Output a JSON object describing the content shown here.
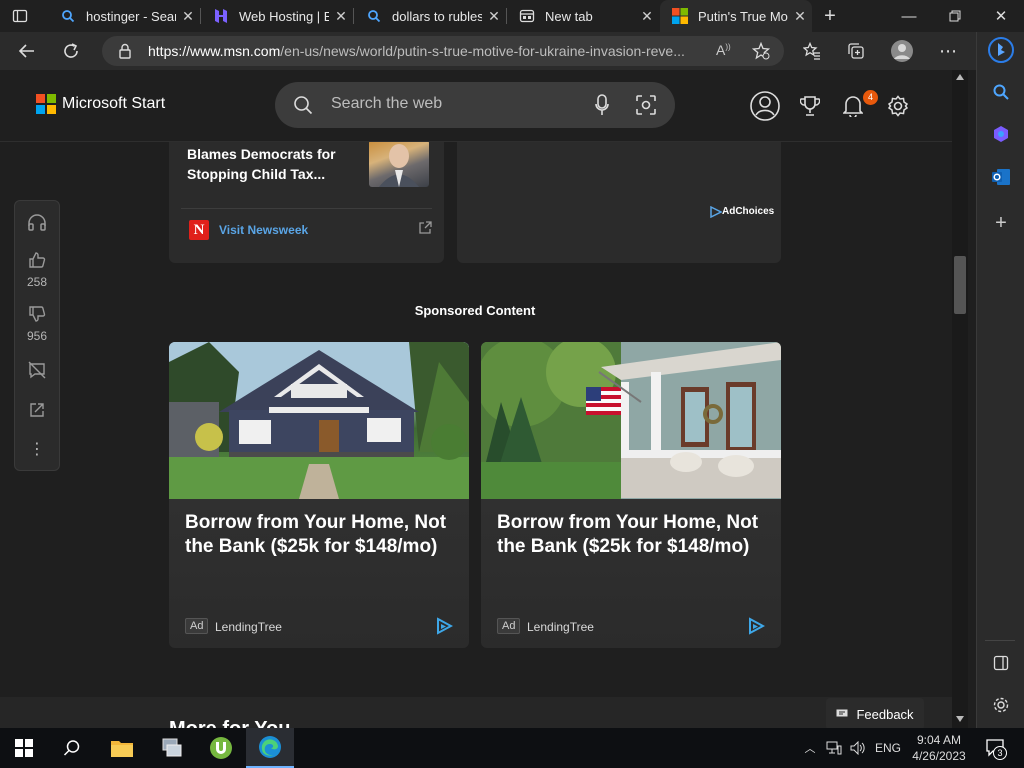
{
  "browser": {
    "tabs": [
      {
        "label": "hostinger - Search",
        "active": false
      },
      {
        "label": "Web Hosting | Ex",
        "active": false
      },
      {
        "label": "dollars to rubles",
        "active": false
      },
      {
        "label": "New tab",
        "active": false
      },
      {
        "label": "Putin's True Mot",
        "active": true
      }
    ],
    "url_host": "https://www.msn.com",
    "url_path": "/en-us/news/world/putin-s-true-motive-for-ukraine-invasion-reve..."
  },
  "header": {
    "brand": "Microsoft Start",
    "search_placeholder": "Search the web",
    "notification_count": "4"
  },
  "sidetools": {
    "likes": "258",
    "dislikes": "956"
  },
  "top_card": {
    "headline": "Blames Democrats for Stopping Child Tax...",
    "visit_link": "Visit Newsweek"
  },
  "ad_panel": {
    "adchoices": "AdChoices"
  },
  "sponsored": {
    "heading": "Sponsored Content",
    "cards": [
      {
        "headline": "Borrow from Your Home, Not the Bank ($25k for $148/mo)",
        "badge": "Ad",
        "source": "LendingTree"
      },
      {
        "headline": "Borrow from Your Home, Not the Bank ($25k for $148/mo)",
        "badge": "Ad",
        "source": "LendingTree"
      }
    ]
  },
  "more_heading": "More for You",
  "feedback_label": "Feedback",
  "taskbar": {
    "lang": "ENG",
    "time": "9:04 AM",
    "date": "4/26/2023",
    "notif_count": "3"
  },
  "colors": {
    "accent_link": "#5aa5e6",
    "notif_badge": "#e8590c"
  }
}
